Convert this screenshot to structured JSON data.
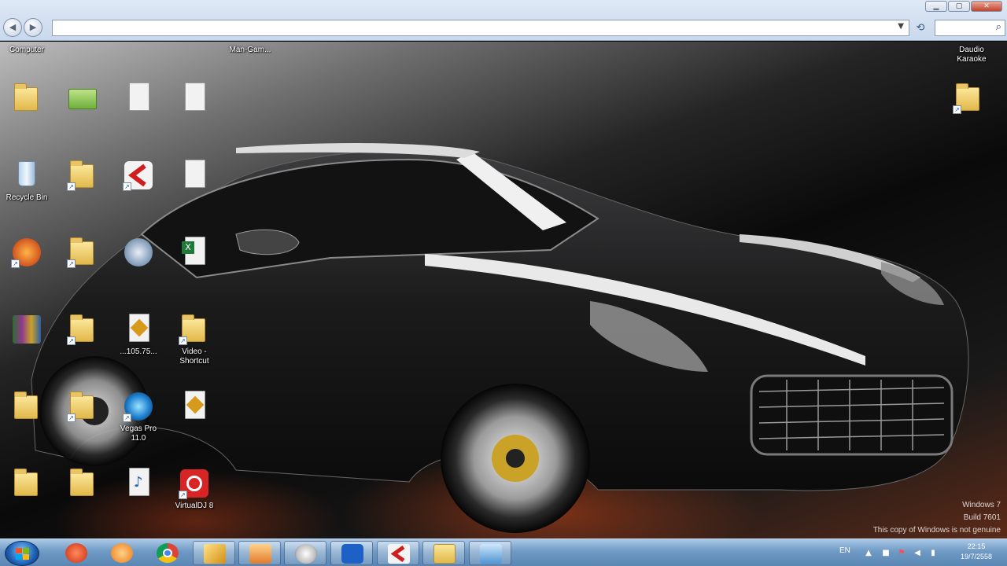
{
  "window": {
    "address_value": "",
    "search_placeholder": "",
    "controls": {
      "minimize": "▁",
      "maximize": "▢",
      "close": "✕"
    }
  },
  "desktop": {
    "top_labels": [
      "Computer",
      "",
      "",
      "",
      "Man-Gam..."
    ],
    "right_icon_top_label": "Daudio\nKaraoke",
    "right_icon_label": "",
    "icons": {
      "col1": [
        "",
        "Recycle Bin",
        "",
        "",
        "",
        ""
      ],
      "col2": [
        "",
        "",
        "",
        "",
        "",
        ""
      ],
      "col3": [
        "",
        "",
        "",
        "...105.75...",
        "Vegas Pro\n11.0",
        ""
      ],
      "col4": [
        "",
        "",
        "",
        "Video -\nShortcut",
        "",
        "VirtualDJ 8"
      ]
    },
    "watermark": {
      "line1": "Windows 7",
      "line2": "Build 7601",
      "line3": "This copy of Windows is not genuine"
    }
  },
  "taskbar": {
    "language": "EN",
    "time": "22:15",
    "date": "19/7/2558",
    "apps": [
      "ccleaner-icon",
      "kmplayer-icon",
      "chrome-icon",
      "aimp-icon",
      "game-icon",
      "panda-icon",
      "maxthon-icon",
      "cyberlink-icon",
      "explorer-icon",
      "remote-desktop-icon"
    ]
  },
  "colors": {
    "taskbar": "#6f9ac4",
    "address_bar": "#dfe9f6",
    "accent_red": "#d01d1d"
  }
}
